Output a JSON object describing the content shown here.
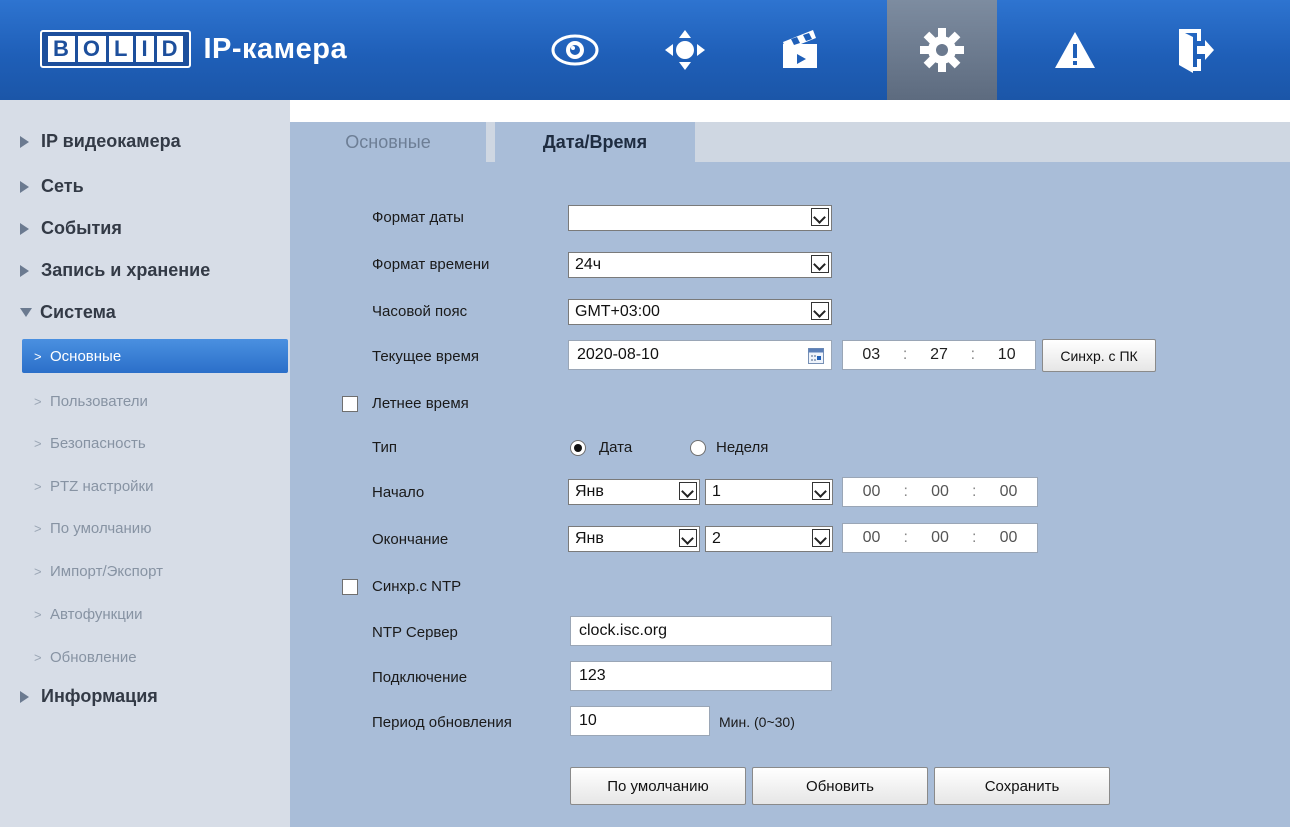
{
  "header": {
    "logo_letters": [
      "B",
      "O",
      "L",
      "I",
      "D"
    ],
    "app_title": "IP-камера",
    "nav": [
      {
        "icon": "eye-icon"
      },
      {
        "icon": "ptz-joystick-icon"
      },
      {
        "icon": "clapperboard-icon"
      },
      {
        "icon": "gear-icon",
        "active": true
      },
      {
        "icon": "warning-icon"
      },
      {
        "icon": "logout-icon"
      }
    ]
  },
  "sidebar": {
    "groups": {
      "ip_camera": "IP видеокамера",
      "network": "Сеть",
      "events": "События",
      "storage": "Запись и хранение",
      "system": "Система",
      "info": "Информация"
    },
    "system_items": [
      {
        "label": "Основные",
        "active": true
      },
      {
        "label": "Пользователи"
      },
      {
        "label": "Безопасность"
      },
      {
        "label": "PTZ настройки"
      },
      {
        "label": "По умолчанию"
      },
      {
        "label": "Импорт/Экспорт"
      },
      {
        "label": "Автофункции"
      },
      {
        "label": "Обновление"
      }
    ]
  },
  "tabs": {
    "general": "Основные",
    "datetime": "Дата/Время"
  },
  "form": {
    "date_format_label": "Формат даты",
    "date_format_value": "",
    "time_format_label": "Формат времени",
    "time_format_value": "24ч",
    "timezone_label": "Часовой пояс",
    "timezone_value": "GMT+03:00",
    "current_time_label": "Текущее время",
    "current_date": "2020-08-10",
    "current_time": {
      "h": "03",
      "m": "27",
      "s": "10"
    },
    "sync_pc_label": "Синхр. с ПК",
    "dst_label": "Летнее время",
    "dst_checked": false,
    "type_label": "Тип",
    "type_date": "Дата",
    "type_week": "Неделя",
    "type_selected": "Дата",
    "start_label": "Начало",
    "start_month": "Янв",
    "start_day": "1",
    "start_time": {
      "h": "00",
      "m": "00",
      "s": "00"
    },
    "end_label": "Окончание",
    "end_month": "Янв",
    "end_day": "2",
    "end_time": {
      "h": "00",
      "m": "00",
      "s": "00"
    },
    "ntp_label": "Синхр.с NTP",
    "ntp_checked": false,
    "ntp_server_label": "NTP Сервер",
    "ntp_server_value": "clock.isc.org",
    "port_label": "Подключение",
    "port_value": "123",
    "period_label": "Период обновления",
    "period_value": "10",
    "period_unit": "Мин. (0~30)"
  },
  "buttons": {
    "default": "По умолчанию",
    "refresh": "Обновить",
    "save": "Сохранить"
  },
  "colors": {
    "header": "#1f5fb8",
    "sidebar": "#d7dde7",
    "content": "#a9bdd8",
    "active_item": "#3a80d6"
  }
}
